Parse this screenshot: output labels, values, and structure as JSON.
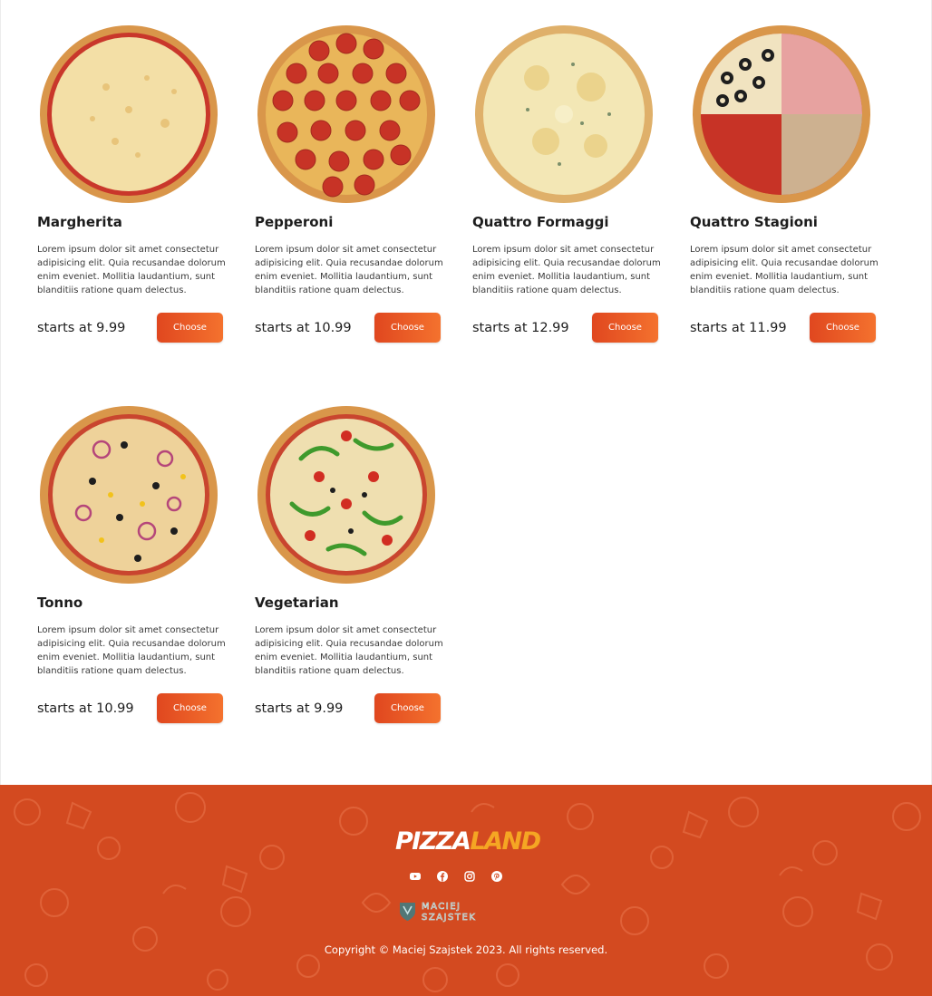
{
  "menu": {
    "pizzas": [
      {
        "name": "Margherita",
        "description": "Lorem ipsum dolor sit amet consectetur adipisicing elit. Quia recusandae dolorum enim eveniet. Mollitia laudantium, sunt blanditiis ratione quam delectus.",
        "price": "starts at 9.99",
        "button": "Choose"
      },
      {
        "name": "Pepperoni",
        "description": "Lorem ipsum dolor sit amet consectetur adipisicing elit. Quia recusandae dolorum enim eveniet. Mollitia laudantium, sunt blanditiis ratione quam delectus.",
        "price": "starts at 10.99",
        "button": "Choose"
      },
      {
        "name": "Quattro Formaggi",
        "description": "Lorem ipsum dolor sit amet consectetur adipisicing elit. Quia recusandae dolorum enim eveniet. Mollitia laudantium, sunt blanditiis ratione quam delectus.",
        "price": "starts at 12.99",
        "button": "Choose"
      },
      {
        "name": "Quattro Stagioni",
        "description": "Lorem ipsum dolor sit amet consectetur adipisicing elit. Quia recusandae dolorum enim eveniet. Mollitia laudantium, sunt blanditiis ratione quam delectus.",
        "price": "starts at 11.99",
        "button": "Choose"
      },
      {
        "name": "Tonno",
        "description": "Lorem ipsum dolor sit amet consectetur adipisicing elit. Quia recusandae dolorum enim eveniet. Mollitia laudantium, sunt blanditiis ratione quam delectus.",
        "price": "starts at 10.99",
        "button": "Choose"
      },
      {
        "name": "Vegetarian",
        "description": "Lorem ipsum dolor sit amet consectetur adipisicing elit. Quia recusandae dolorum enim eveniet. Mollitia laudantium, sunt blanditiis ratione quam delectus.",
        "price": "starts at 9.99",
        "button": "Choose"
      }
    ]
  },
  "footer": {
    "logo_part1": "PIZZA",
    "logo_part2": "LAND",
    "socials": [
      "youtube-icon",
      "facebook-icon",
      "instagram-icon",
      "pinterest-icon"
    ],
    "author_logo_line1": "MACIEJ",
    "author_logo_line2": "SZAJSTEK",
    "copyright": "Copyright © Maciej Szajstek 2023. All rights reserved."
  },
  "colors": {
    "accent": "#e0471f",
    "accent_light": "#f4722e",
    "footer_bg": "#d34a20",
    "logo_orange": "#f5a623"
  }
}
